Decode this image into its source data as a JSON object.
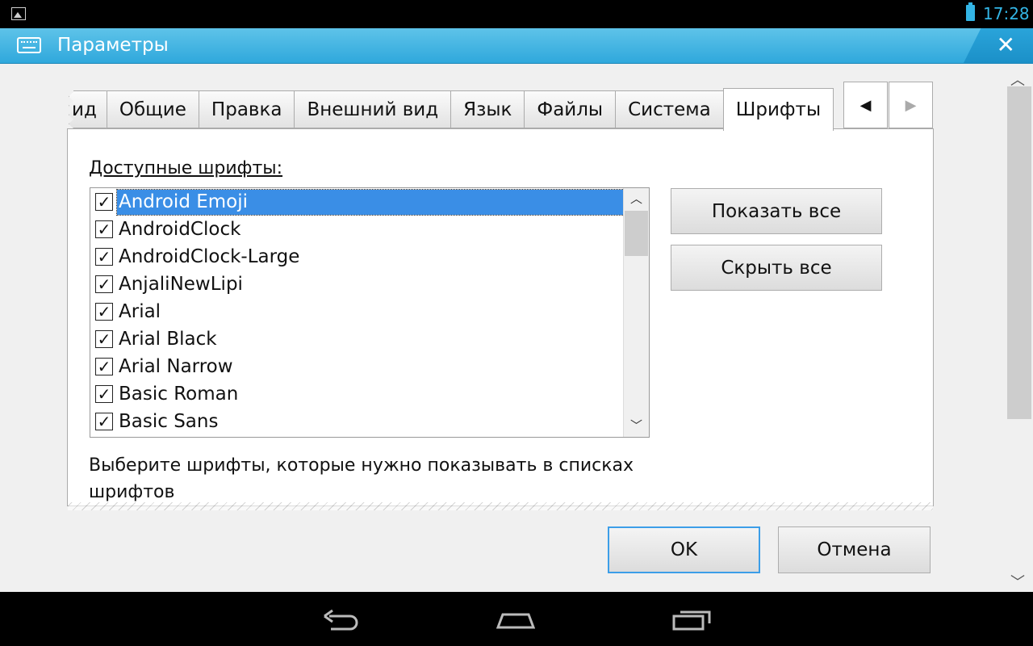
{
  "status_bar": {
    "time": "17:28",
    "icons": [
      "gallery-icon",
      "battery-icon"
    ],
    "accent": "#33b5e5"
  },
  "window": {
    "title": "Параметры",
    "icons": [
      "keyboard-icon",
      "close-icon"
    ],
    "close_label": "✕"
  },
  "tabs": [
    {
      "label": "ид",
      "state": "partial"
    },
    {
      "label": "Общие"
    },
    {
      "label": "Правка"
    },
    {
      "label": "Внешний вид"
    },
    {
      "label": "Язык"
    },
    {
      "label": "Файлы"
    },
    {
      "label": "Система"
    },
    {
      "label": "Шрифты",
      "state": "active"
    }
  ],
  "tab_nav": {
    "prev": "◀",
    "next": "▶"
  },
  "fonts_panel": {
    "label": "Доступные шрифты:",
    "fonts": [
      {
        "name": "Android Emoji",
        "checked": true,
        "selected": true
      },
      {
        "name": "AndroidClock",
        "checked": true
      },
      {
        "name": "AndroidClock-Large",
        "checked": true
      },
      {
        "name": "AnjaliNewLipi",
        "checked": true
      },
      {
        "name": "Arial",
        "checked": true
      },
      {
        "name": "Arial Black",
        "checked": true
      },
      {
        "name": "Arial Narrow",
        "checked": true
      },
      {
        "name": "Basic Roman",
        "checked": true
      },
      {
        "name": "Basic Sans",
        "checked": true
      }
    ],
    "show_all": "Показать все",
    "hide_all": "Скрыть все",
    "hint": "Выберите шрифты, которые нужно показывать в списках шрифтов"
  },
  "buttons": {
    "ok": "OK",
    "cancel": "Отмена"
  },
  "nav_bar": {
    "icons": [
      "back-icon",
      "home-icon",
      "recents-icon"
    ]
  },
  "colors": {
    "title_bar": "#33a9dd",
    "selection": "#3a8ee6",
    "focus_border": "#3c9ee8"
  }
}
